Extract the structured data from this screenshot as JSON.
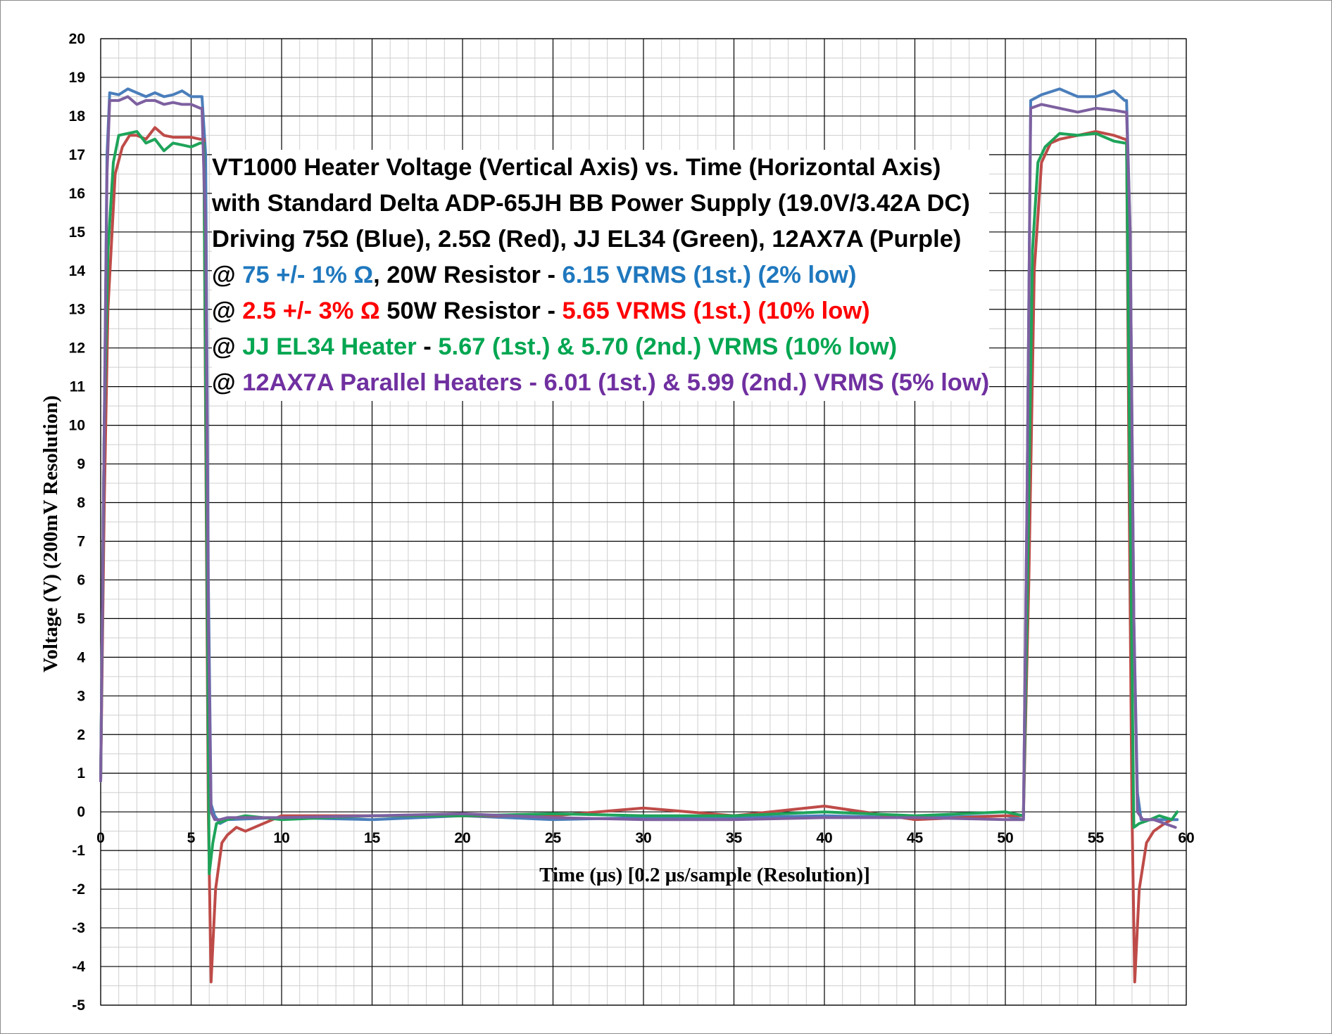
{
  "chart_data": {
    "type": "line",
    "xlabel": "Time (μs) [0.2 μs/sample (Resolution)]",
    "ylabel": "Voltage (V) (200mV Resolution)",
    "xlim": [
      0,
      60
    ],
    "ylim": [
      -5,
      20
    ],
    "x_major_ticks": [
      0,
      5,
      10,
      15,
      20,
      25,
      30,
      35,
      40,
      45,
      50,
      55,
      60
    ],
    "y_major_ticks": [
      -5,
      -4,
      -3,
      -2,
      -1,
      0,
      1,
      2,
      3,
      4,
      5,
      6,
      7,
      8,
      9,
      10,
      11,
      12,
      13,
      14,
      15,
      16,
      17,
      18,
      19,
      20
    ],
    "x_minor_step": 1,
    "y_minor_step": 0.5,
    "grid": true,
    "legend": "none",
    "colors": {
      "blue": "#4a7ebb",
      "red": "#be4b48",
      "green": "#1ea45a",
      "purple": "#7d60a0"
    },
    "series": [
      {
        "color": "#4a7ebb",
        "points": [
          [
            0,
            0.8
          ],
          [
            0.2,
            10
          ],
          [
            0.35,
            17
          ],
          [
            0.5,
            18.6
          ],
          [
            1,
            18.55
          ],
          [
            1.5,
            18.7
          ],
          [
            2,
            18.6
          ],
          [
            2.5,
            18.5
          ],
          [
            3,
            18.6
          ],
          [
            3.5,
            18.5
          ],
          [
            4,
            18.55
          ],
          [
            4.5,
            18.65
          ],
          [
            5,
            18.5
          ],
          [
            5.5,
            18.5
          ],
          [
            5.6,
            18.5
          ],
          [
            5.8,
            17
          ],
          [
            5.95,
            6
          ],
          [
            6.1,
            0.2
          ],
          [
            6.3,
            -0.1
          ],
          [
            6.6,
            -0.3
          ],
          [
            7,
            -0.2
          ],
          [
            10,
            -0.15
          ],
          [
            15,
            -0.2
          ],
          [
            20,
            -0.1
          ],
          [
            25,
            -0.2
          ],
          [
            30,
            -0.15
          ],
          [
            35,
            -0.15
          ],
          [
            40,
            -0.1
          ],
          [
            45,
            -0.15
          ],
          [
            50,
            -0.1
          ],
          [
            51,
            -0.2
          ],
          [
            51.2,
            8
          ],
          [
            51.4,
            18.4
          ],
          [
            52,
            18.55
          ],
          [
            53,
            18.7
          ],
          [
            54,
            18.5
          ],
          [
            55,
            18.5
          ],
          [
            56,
            18.65
          ],
          [
            56.6,
            18.4
          ],
          [
            56.7,
            18.4
          ],
          [
            56.9,
            15
          ],
          [
            57.1,
            5
          ],
          [
            57.3,
            0.5
          ],
          [
            57.5,
            -0.2
          ],
          [
            58.5,
            -0.2
          ],
          [
            59,
            -0.2
          ],
          [
            59.5,
            -0.2
          ]
        ]
      },
      {
        "color": "#be4b48",
        "points": [
          [
            0,
            0.8
          ],
          [
            0.2,
            8
          ],
          [
            0.4,
            13
          ],
          [
            0.8,
            16.5
          ],
          [
            1.2,
            17.2
          ],
          [
            1.6,
            17.5
          ],
          [
            2,
            17.5
          ],
          [
            2.5,
            17.4
          ],
          [
            3,
            17.7
          ],
          [
            3.5,
            17.5
          ],
          [
            4,
            17.45
          ],
          [
            5,
            17.45
          ],
          [
            5.5,
            17.4
          ],
          [
            5.7,
            17.4
          ],
          [
            5.8,
            10
          ],
          [
            5.95,
            0
          ],
          [
            6.1,
            -4.4
          ],
          [
            6.35,
            -2
          ],
          [
            6.7,
            -0.8
          ],
          [
            7,
            -0.6
          ],
          [
            7.5,
            -0.4
          ],
          [
            8,
            -0.5
          ],
          [
            9,
            -0.3
          ],
          [
            10,
            -0.1
          ],
          [
            15,
            -0.1
          ],
          [
            20,
            -0.1
          ],
          [
            25,
            -0.1
          ],
          [
            30,
            0.1
          ],
          [
            35,
            -0.1
          ],
          [
            40,
            0.15
          ],
          [
            45,
            -0.2
          ],
          [
            50,
            -0.1
          ],
          [
            51,
            -0.1
          ],
          [
            51.3,
            6
          ],
          [
            51.6,
            14
          ],
          [
            52,
            16.8
          ],
          [
            52.5,
            17.3
          ],
          [
            53,
            17.4
          ],
          [
            54,
            17.5
          ],
          [
            55,
            17.6
          ],
          [
            56,
            17.5
          ],
          [
            56.6,
            17.4
          ],
          [
            56.7,
            17.4
          ],
          [
            56.85,
            8
          ],
          [
            57,
            0
          ],
          [
            57.15,
            -4.4
          ],
          [
            57.4,
            -2
          ],
          [
            57.8,
            -0.8
          ],
          [
            58.2,
            -0.5
          ],
          [
            58.8,
            -0.3
          ],
          [
            59.2,
            -0.2
          ]
        ]
      },
      {
        "color": "#1ea45a",
        "points": [
          [
            0,
            0.8
          ],
          [
            0.2,
            10
          ],
          [
            0.4,
            14.5
          ],
          [
            0.7,
            16.8
          ],
          [
            1,
            17.5
          ],
          [
            1.5,
            17.55
          ],
          [
            2,
            17.6
          ],
          [
            2.5,
            17.3
          ],
          [
            3,
            17.4
          ],
          [
            3.5,
            17.1
          ],
          [
            4,
            17.3
          ],
          [
            4.5,
            17.25
          ],
          [
            5,
            17.2
          ],
          [
            5.5,
            17.3
          ],
          [
            5.7,
            17.3
          ],
          [
            5.85,
            8
          ],
          [
            6,
            -1.6
          ],
          [
            6.2,
            -0.8
          ],
          [
            6.4,
            -0.3
          ],
          [
            7,
            -0.2
          ],
          [
            8,
            -0.1
          ],
          [
            10,
            -0.2
          ],
          [
            15,
            -0.1
          ],
          [
            20,
            -0.1
          ],
          [
            25,
            -0.05
          ],
          [
            30,
            -0.1
          ],
          [
            35,
            -0.1
          ],
          [
            40,
            0
          ],
          [
            45,
            -0.1
          ],
          [
            50,
            0
          ],
          [
            51,
            -0.1
          ],
          [
            51.2,
            5
          ],
          [
            51.5,
            14.5
          ],
          [
            51.8,
            16.8
          ],
          [
            52.2,
            17.2
          ],
          [
            53,
            17.55
          ],
          [
            54,
            17.5
          ],
          [
            55,
            17.55
          ],
          [
            56,
            17.35
          ],
          [
            56.6,
            17.3
          ],
          [
            56.7,
            17.3
          ],
          [
            56.9,
            8
          ],
          [
            57.1,
            -0.4
          ],
          [
            57.4,
            -0.3
          ],
          [
            58,
            -0.2
          ],
          [
            58.5,
            -0.1
          ],
          [
            59.2,
            -0.2
          ],
          [
            59.5,
            0
          ]
        ]
      },
      {
        "color": "#7d60a0",
        "points": [
          [
            0,
            0.8
          ],
          [
            0.2,
            10
          ],
          [
            0.35,
            16.5
          ],
          [
            0.5,
            18.4
          ],
          [
            1,
            18.4
          ],
          [
            1.5,
            18.5
          ],
          [
            2,
            18.3
          ],
          [
            2.5,
            18.4
          ],
          [
            3,
            18.4
          ],
          [
            3.5,
            18.3
          ],
          [
            4,
            18.35
          ],
          [
            4.5,
            18.3
          ],
          [
            5,
            18.3
          ],
          [
            5.5,
            18.2
          ],
          [
            5.6,
            18.2
          ],
          [
            5.8,
            15
          ],
          [
            5.95,
            5
          ],
          [
            6.1,
            0
          ],
          [
            6.3,
            -0.2
          ],
          [
            6.6,
            -0.2
          ],
          [
            7,
            -0.15
          ],
          [
            10,
            -0.15
          ],
          [
            15,
            -0.1
          ],
          [
            20,
            -0.05
          ],
          [
            25,
            -0.15
          ],
          [
            30,
            -0.2
          ],
          [
            35,
            -0.2
          ],
          [
            40,
            -0.15
          ],
          [
            45,
            -0.15
          ],
          [
            50,
            -0.2
          ],
          [
            51,
            -0.2
          ],
          [
            51.2,
            8
          ],
          [
            51.4,
            18.2
          ],
          [
            52,
            18.3
          ],
          [
            53,
            18.2
          ],
          [
            54,
            18.1
          ],
          [
            55,
            18.2
          ],
          [
            56,
            18.15
          ],
          [
            56.6,
            18.1
          ],
          [
            56.7,
            18.1
          ],
          [
            56.9,
            15
          ],
          [
            57.1,
            5
          ],
          [
            57.3,
            0
          ],
          [
            57.6,
            -0.2
          ],
          [
            58.2,
            -0.2
          ],
          [
            58.8,
            -0.3
          ],
          [
            59.4,
            -0.4
          ]
        ]
      }
    ]
  },
  "annotation": {
    "line1": "VT1000 Heater Voltage (Vertical Axis)  vs. Time (Horizontal Axis)",
    "line2": "with Standard Delta ADP-65JH BB Power Supply (19.0V/3.42A DC)",
    "line3": "Driving 75Ω (Blue), 2.5Ω (Red), JJ EL34 (Green), 12AX7A (Purple)",
    "line4": {
      "at": "@ ",
      "spec": "75 +/- 1% Ω",
      "mid": ", 20W Resistor - ",
      "value": "6.15 VRMS (1st.) (2% low)"
    },
    "line5": {
      "at": "@ ",
      "spec": "2.5 +/- 3% Ω",
      "mid": " 50W Resistor  - ",
      "value": "5.65 VRMS (1st.) (10% low)"
    },
    "line6": {
      "at": "@ ",
      "spec": "JJ EL34 Heater",
      "mid": " - ",
      "value": "5.67 (1st.) & 5.70 (2nd.) VRMS (10% low)"
    },
    "line7": {
      "at": "@ ",
      "spec": "12AX7A Parallel Heaters",
      "mid": " - ",
      "value": "6.01 (1st.) & 5.99 (2nd.) VRMS  (5% low)"
    },
    "text_colors": {
      "blue": "#1f78be",
      "red": "#ff0000",
      "green": "#00a651",
      "purple": "#7030a0"
    }
  }
}
